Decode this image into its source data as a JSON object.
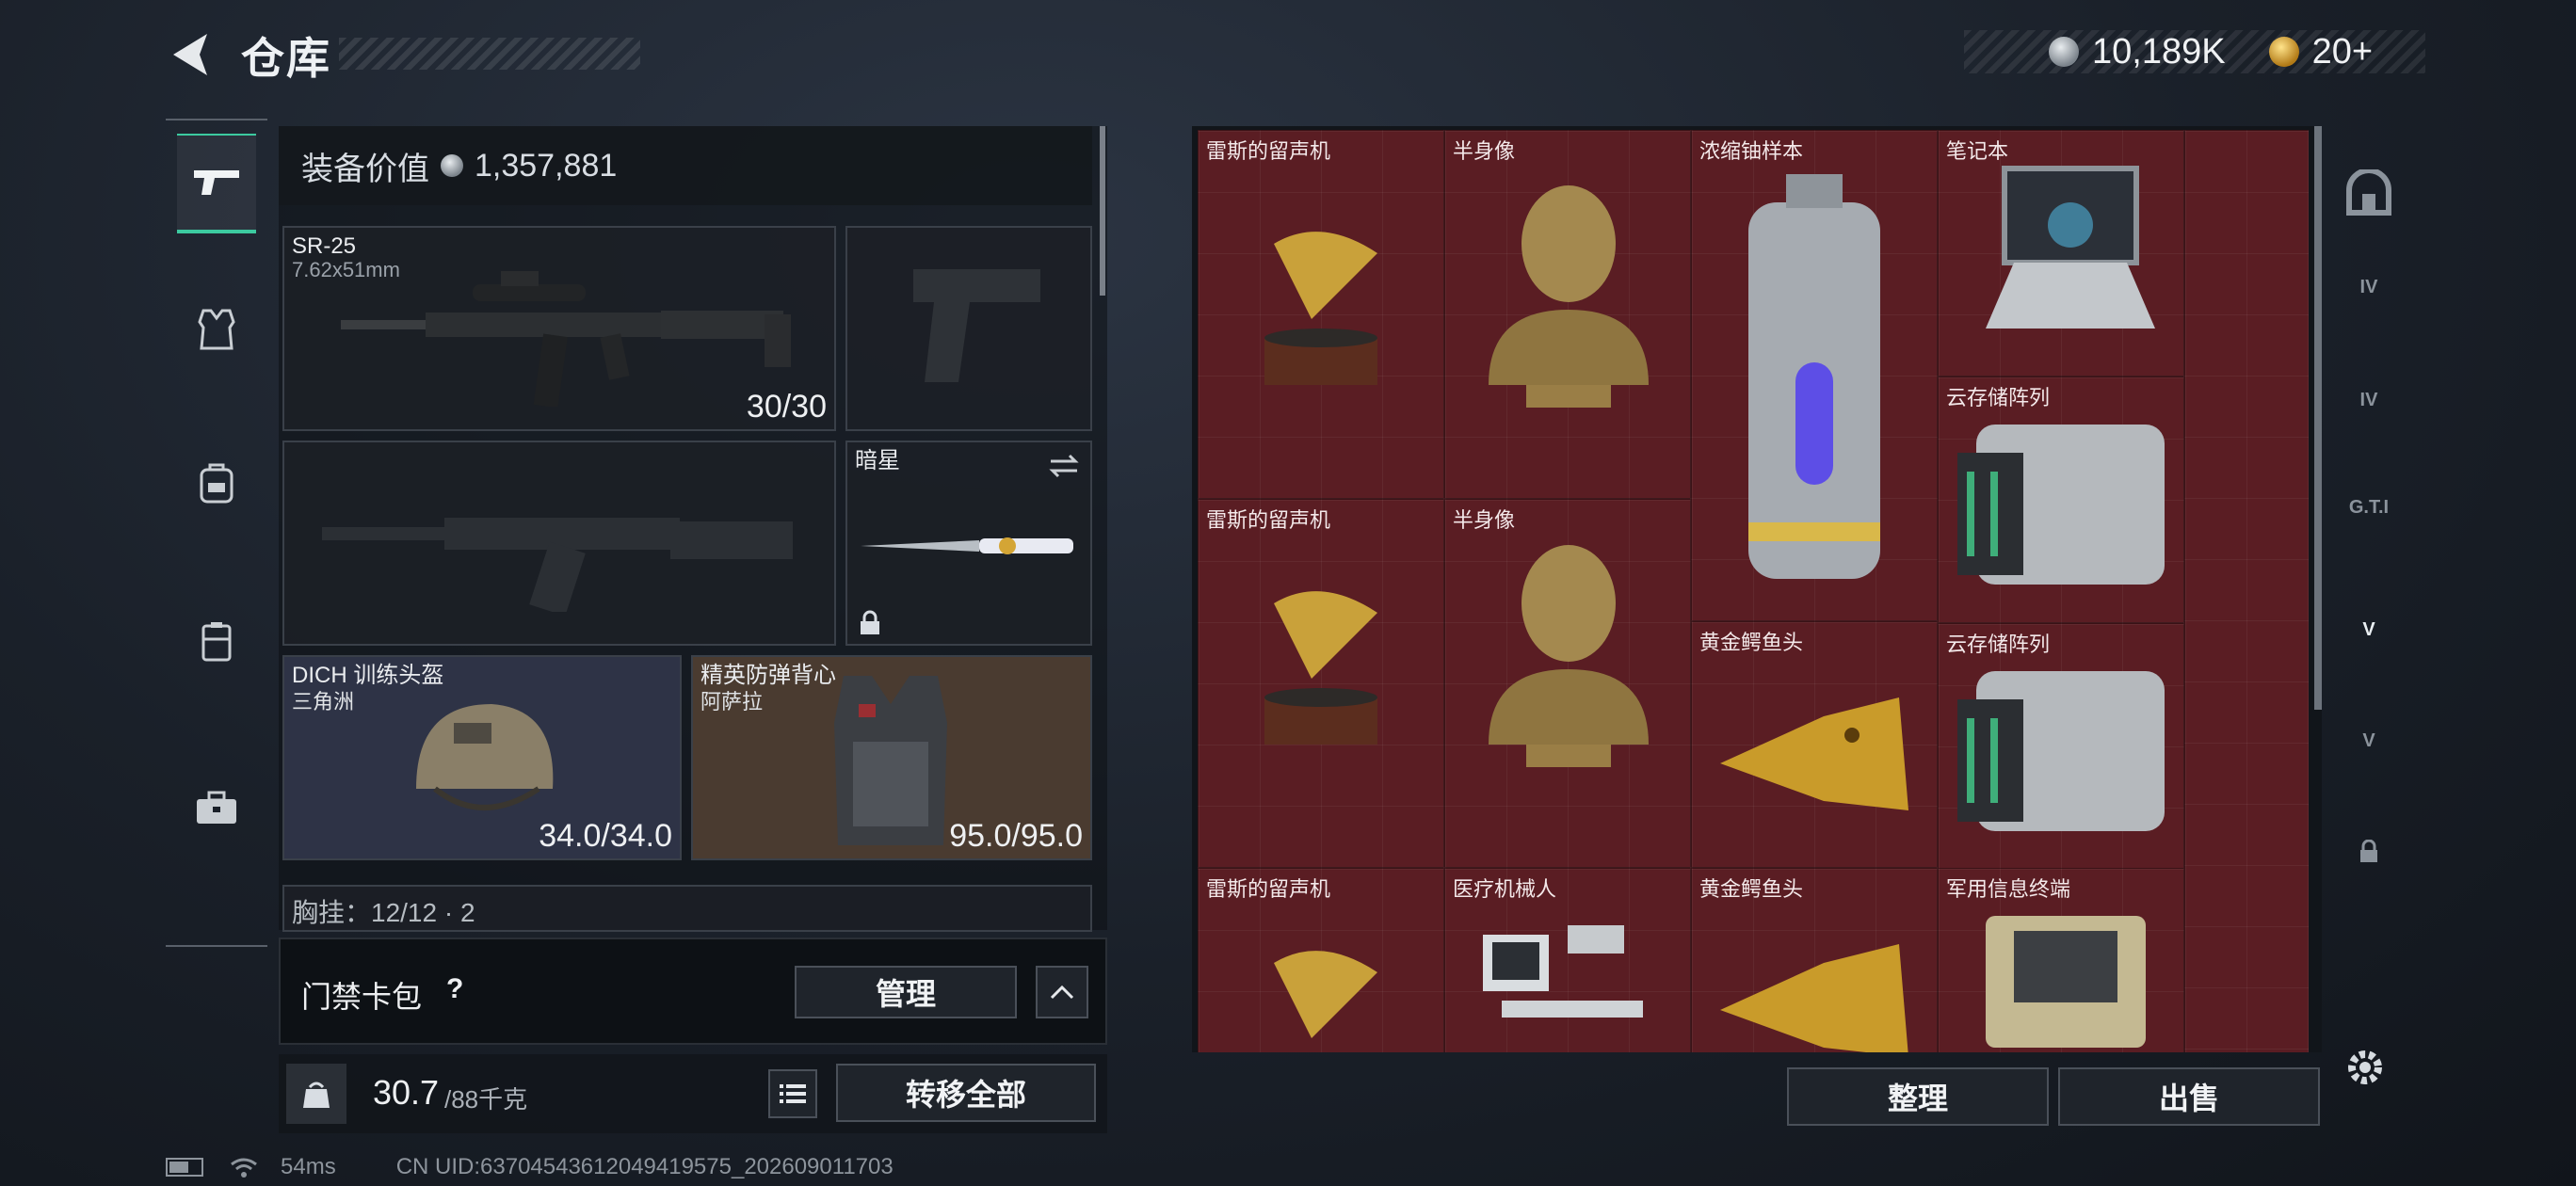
{
  "header": {
    "title": "仓库",
    "currency_primary": "10,189K",
    "currency_secondary": "20+"
  },
  "left_nav": {
    "items": [
      "pistol-icon",
      "vest-icon",
      "backpack-icon",
      "chest-rig-icon",
      "toolbox-icon"
    ]
  },
  "equipment": {
    "value_label": "装备价值",
    "value": "1,357,881",
    "primary_weapon": {
      "name": "SR-25",
      "caliber": "7.62x51mm",
      "ammo": "30/30"
    },
    "melee": {
      "name": "暗星"
    },
    "helmet": {
      "name": "DICH 训练头盔",
      "sub": "三角洲",
      "durability": "34.0/34.0"
    },
    "armor": {
      "name": "精英防弹背心",
      "sub": "阿萨拉",
      "durability": "95.0/95.0"
    },
    "chest_rig_partial": "胸挂：12/12 · 2"
  },
  "card_pack": {
    "label": "门禁卡包",
    "help": "?",
    "manage_label": "管理"
  },
  "weight": {
    "current": "30.7",
    "max": "/88千克",
    "transfer_all_label": "转移全部"
  },
  "stash_items": [
    {
      "label": "雷斯的留声机",
      "icon": "gramophone"
    },
    {
      "label": "半身像",
      "icon": "bust"
    },
    {
      "label": "浓缩铀样本",
      "icon": "uranium-canister"
    },
    {
      "label": "笔记本",
      "icon": "laptop"
    },
    {
      "label": "云存储阵列",
      "icon": "storage-array"
    },
    {
      "label": "雷斯的留声机",
      "icon": "gramophone"
    },
    {
      "label": "半身像",
      "icon": "bust"
    },
    {
      "label": "黄金鳄鱼头",
      "icon": "gold-crocodile-head"
    },
    {
      "label": "云存储阵列",
      "icon": "storage-array"
    },
    {
      "label": "雷斯的留声机",
      "icon": "gramophone"
    },
    {
      "label": "医疗机械人",
      "icon": "medical-robot"
    },
    {
      "label": "黄金鳄鱼头",
      "icon": "gold-crocodile-head"
    },
    {
      "label": "军用信息终端",
      "icon": "military-terminal"
    }
  ],
  "actions": {
    "sort_label": "整理",
    "sell_label": "出售"
  },
  "right_nav": {
    "items": [
      "backpack-tab",
      "IV",
      "IV",
      "G.T.I",
      "V",
      "V",
      "lock"
    ]
  },
  "status": {
    "ping": "54ms",
    "uid": "CN UID:6370454361204941957​5_202609011703"
  },
  "colors": {
    "accent": "#3ccaa0",
    "stash_bg": "#5c1f25"
  }
}
